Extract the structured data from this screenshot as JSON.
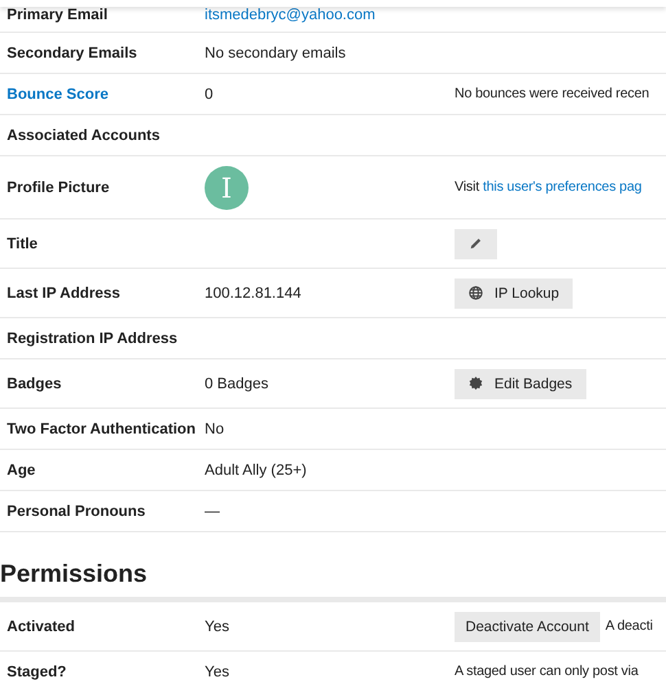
{
  "profile_rows": [
    {
      "label": "Primary Email",
      "label_link": false,
      "value": {
        "kind": "link",
        "text": "itsmedebryc@yahoo.com"
      }
    },
    {
      "label": "Secondary Emails",
      "label_link": false,
      "value": {
        "kind": "text",
        "text": "No secondary emails"
      }
    },
    {
      "label": "Bounce Score",
      "label_link": true,
      "value": {
        "kind": "text",
        "text": "0"
      },
      "action": {
        "kind": "note",
        "text": "No bounces were received recen"
      }
    },
    {
      "label": "Associated Accounts",
      "label_link": false
    },
    {
      "label": "Profile Picture",
      "label_link": false,
      "value": {
        "kind": "avatar",
        "text": "I"
      },
      "action": {
        "kind": "linknote",
        "text": "Visit",
        "link": "this user's preferences pag"
      }
    },
    {
      "label": "Title",
      "label_link": false,
      "action": {
        "kind": "edit"
      }
    },
    {
      "label": "Last IP Address",
      "label_link": false,
      "value": {
        "kind": "text",
        "text": "100.12.81.144"
      },
      "action": {
        "kind": "lookup",
        "text": "IP Lookup"
      }
    },
    {
      "label": "Registration IP Address",
      "label_link": false
    },
    {
      "label": "Badges",
      "label_link": false,
      "value": {
        "kind": "text",
        "text": "0 Badges"
      },
      "action": {
        "kind": "badges",
        "text": "Edit Badges"
      }
    },
    {
      "label": "Two Factor Authentication",
      "label_link": false,
      "value": {
        "kind": "text",
        "text": "No"
      }
    },
    {
      "label": "Age",
      "label_link": false,
      "value": {
        "kind": "text",
        "text": "Adult Ally (25+)"
      }
    },
    {
      "label": "Personal Pronouns",
      "label_link": false,
      "value": {
        "kind": "text",
        "text": "—"
      }
    }
  ],
  "permissions": {
    "title": "Permissions",
    "rows": [
      {
        "label": "Activated",
        "value": "Yes",
        "action": {
          "kind": "plain",
          "text": "Deactivate Account",
          "note": "A deacti"
        }
      },
      {
        "label": "Staged?",
        "value": "Yes",
        "action": {
          "kind": "note",
          "text": "A staged user can only post via"
        }
      }
    ]
  }
}
